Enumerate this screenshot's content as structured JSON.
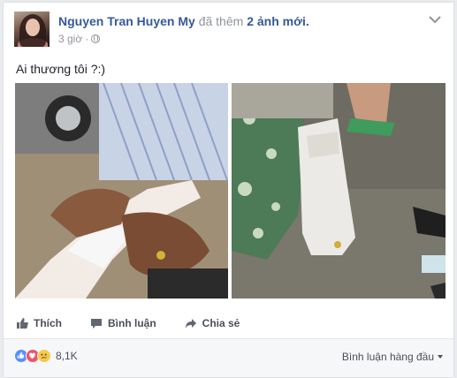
{
  "post": {
    "author": "Nguyen Tran Huyen My",
    "action_prefix": "đã thêm",
    "action_strong": "2 ảnh mới.",
    "time": "3 giờ",
    "privacy_dot": "·",
    "text": "Ai thương tôi ?:)"
  },
  "photos": [
    {
      "name": "photo-1"
    },
    {
      "name": "photo-2"
    }
  ],
  "actions": {
    "like_label": "Thích",
    "comment_label": "Bình luận",
    "share_label": "Chia sẻ"
  },
  "footer": {
    "reactions": [
      "like-icon",
      "love-icon",
      "sad-icon"
    ],
    "reaction_count": "8,1K",
    "sort_label": "Bình luận hàng đầu"
  },
  "colors": {
    "link": "#365899",
    "muted": "#90949c",
    "like": "#5890ff",
    "love": "#f25268",
    "sad": "#f7c94c"
  }
}
